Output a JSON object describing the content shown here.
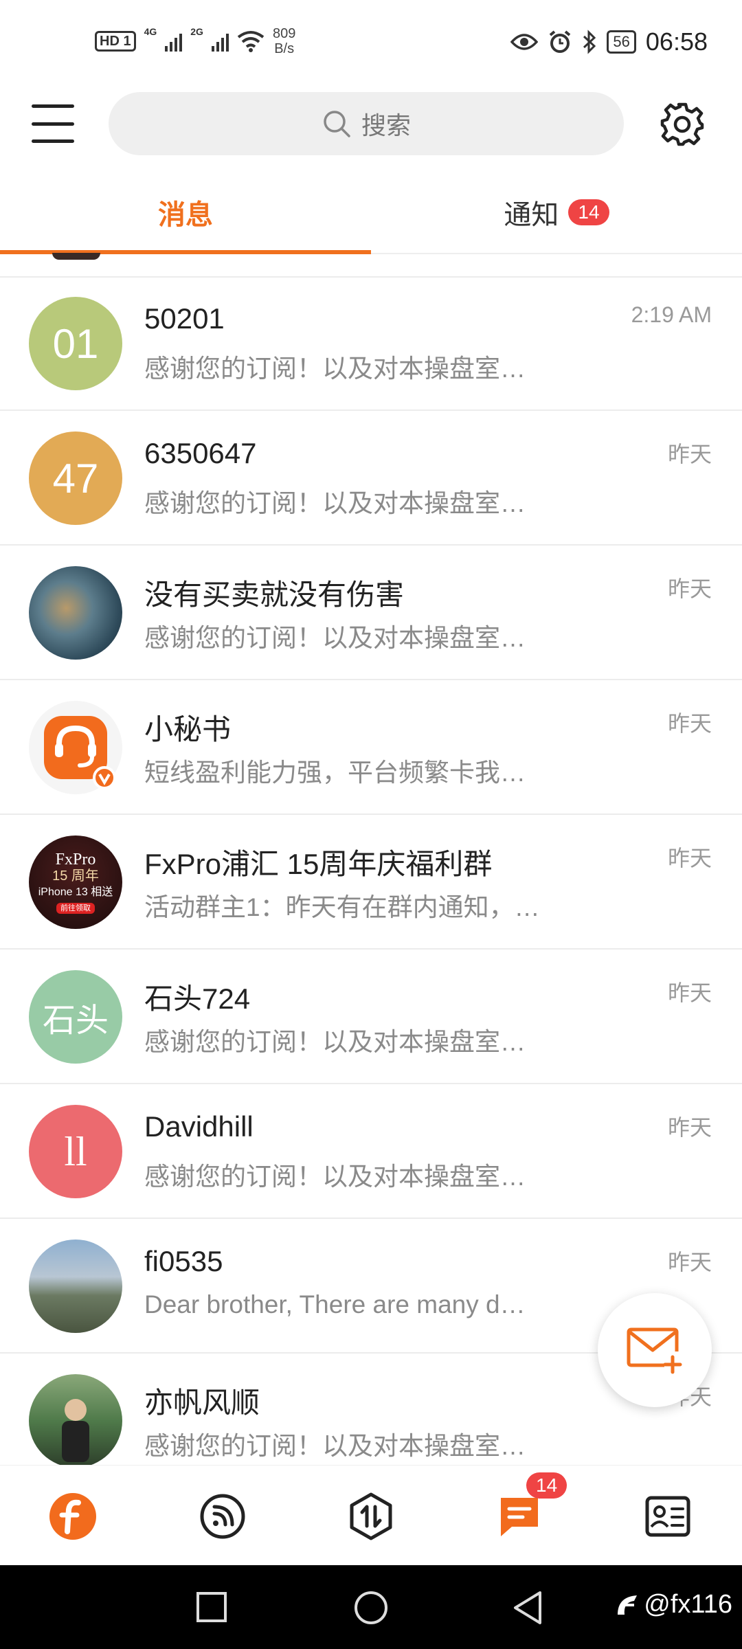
{
  "status_bar": {
    "hd": "HD",
    "sim": "1",
    "net1": "4G",
    "net2": "2G",
    "speed_value": "809",
    "speed_unit": "B/s",
    "battery": "56",
    "time": "06:58"
  },
  "header": {
    "search_placeholder": "搜索"
  },
  "tabs": [
    {
      "label": "消息",
      "active": true
    },
    {
      "label": "通知",
      "badge": "14",
      "active": false
    }
  ],
  "conversations": [
    {
      "name": "50201",
      "preview": "感谢您的订阅！以及对本操盘室…",
      "time": "2:19 AM",
      "avatar_text": "01",
      "avatar_color": "#b8c97a"
    },
    {
      "name": "6350647",
      "preview": "感谢您的订阅！以及对本操盘室…",
      "time": "昨天",
      "avatar_text": "47",
      "avatar_color": "#e2aa55"
    },
    {
      "name": "没有买卖就没有伤害",
      "preview": "感谢您的订阅！以及对本操盘室…",
      "time": "昨天",
      "avatar_text": "",
      "avatar_color": "#3f5e70"
    },
    {
      "name": "小秘书",
      "preview": "短线盈利能力强，平台频繁卡我…",
      "time": "昨天",
      "avatar_text": "",
      "avatar_color": "#f5f5f5"
    },
    {
      "name": "FxPro浦汇 15周年庆福利群",
      "preview": "活动群主1：昨天有在群内通知，…",
      "time": "昨天",
      "avatar_text": "",
      "avatar_color": "#2b1414",
      "avatar_lines": [
        "FxPro",
        "15 周年",
        "iPhone 13 相送",
        "前往领取"
      ]
    },
    {
      "name": "石头724",
      "preview": "感谢您的订阅！以及对本操盘室…",
      "time": "昨天",
      "avatar_text": "石头",
      "avatar_color": "#98cba6"
    },
    {
      "name": "Davidhill",
      "preview": "感谢您的订阅！以及对本操盘室…",
      "time": "昨天",
      "avatar_text": "ll",
      "avatar_color": "#ec6a6f"
    },
    {
      "name": "fi0535",
      "preview": " Dear brother, There are many d…",
      "time": "昨天",
      "avatar_text": "",
      "avatar_color": "#6b7a62"
    },
    {
      "name": "亦帆风顺",
      "preview": "感谢您的订阅！以及对本操盘室…",
      "time": "昨天",
      "avatar_text": "",
      "avatar_color": "#4f7a4a"
    }
  ],
  "bottom_nav": {
    "messages_badge": "14"
  },
  "watermark": "@fx116",
  "colors": {
    "accent": "#f0701e",
    "badge": "#ef4444"
  }
}
